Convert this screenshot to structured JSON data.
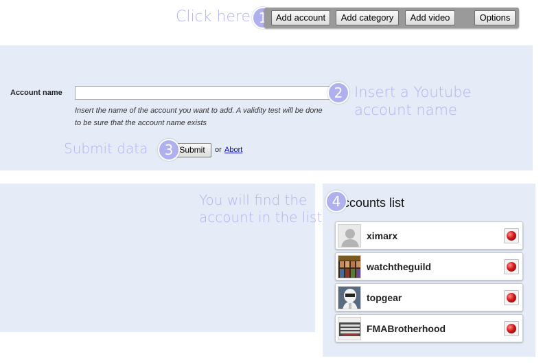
{
  "toolbar": {
    "add_account": "Add account",
    "add_category": "Add category",
    "add_video": "Add video",
    "options": "Options"
  },
  "annotations": {
    "step1_text": "Click here",
    "step1_num": "1",
    "step2_line1": "Insert a Youtube",
    "step2_line2": "account name",
    "step2_num": "2",
    "step3_text": "Submit data",
    "step3_num": "3",
    "step4_line1": "You will find the",
    "step4_line2": "account in the list",
    "step4_num": "4"
  },
  "form": {
    "label": "Account name",
    "value": "",
    "help_line1": "Insert the name of the account you want to add. A validity test will be done",
    "help_line2": "to be sure that the account name exists",
    "submit_label": "Submit",
    "or_text": "or",
    "abort_label": "Abort"
  },
  "accounts": {
    "title": "Accounts list",
    "items": [
      {
        "name": "ximarx",
        "thumb": "default-avatar-icon"
      },
      {
        "name": "watchtheguild",
        "thumb": "guild-avatar-icon"
      },
      {
        "name": "topgear",
        "thumb": "stig-avatar-icon"
      },
      {
        "name": "FMABrotherhood",
        "thumb": "fma-avatar-icon"
      }
    ]
  },
  "colors": {
    "panel_bg": "#e5ebf7",
    "annotation": "#b3b3ef",
    "badge": "#b0b0ee",
    "toolbar_bg": "#9a9a9a",
    "delete_red": "#d01a1a"
  }
}
